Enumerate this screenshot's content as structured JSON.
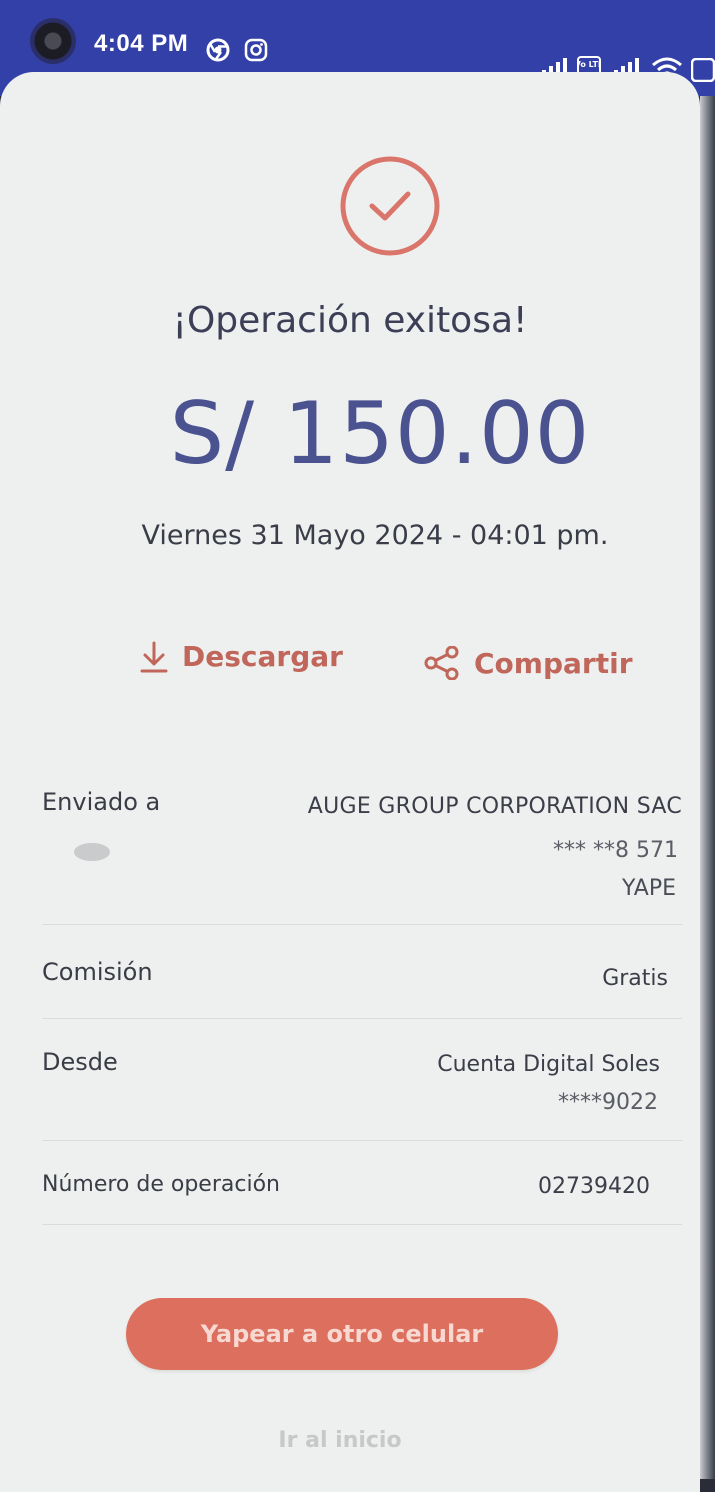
{
  "status_bar": {
    "time": "4:04 PM",
    "icons": [
      "chrome-icon",
      "instagram-icon",
      "signal-icon",
      "volte-icon",
      "signal-icon",
      "wifi-icon",
      "battery-icon"
    ],
    "volte_label": "Vo LTE"
  },
  "colors": {
    "accent": "#dc6f5e",
    "amount": "#4a5290",
    "status_bar": "#3340a8"
  },
  "header": {
    "title": "¡Operación exitosa!",
    "amount": "S/ 150.00",
    "date": "Viernes 31 Mayo 2024 - 04:01 pm."
  },
  "actions": {
    "download_label": "Descargar",
    "share_label": "Compartir"
  },
  "details": {
    "sent_to": {
      "label": "Enviado a",
      "name": "AUGE GROUP CORPORATION SAC",
      "phone": "*** **8 571",
      "channel": "YAPE"
    },
    "fee": {
      "label": "Comisión",
      "value": "Gratis"
    },
    "from": {
      "label": "Desde",
      "account": "Cuenta Digital Soles",
      "number": "****9022"
    },
    "operation": {
      "label": "Número de operación",
      "value": "02739420"
    }
  },
  "footer": {
    "primary_button": "Yapear a otro celular",
    "home_link": "Ir al inicio"
  }
}
